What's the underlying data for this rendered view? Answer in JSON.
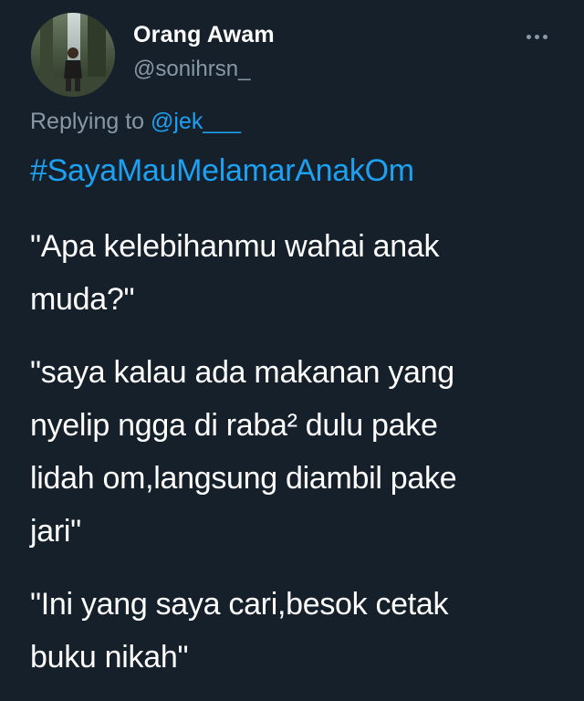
{
  "tweet": {
    "author": {
      "display_name": "Orang Awam",
      "handle": "@sonihrsn_",
      "avatar_icon": "user-avatar-photo"
    },
    "more_icon": "more-horizontal-icon",
    "replying_to": {
      "prefix": "Replying to ",
      "mention": "@jek___"
    },
    "hashtag": "#SayaMauMelamarAnakOm",
    "paragraphs": [
      "\"Apa kelebihanmu wahai anak\nmuda?\"",
      "\"saya kalau ada makanan yang\nnyelip ngga di raba² dulu pake\nlidah om,langsung diambil pake\njari\"",
      "\"Ini yang saya cari,besok cetak\nbuku nikah\""
    ]
  },
  "colors": {
    "background": "#15202b",
    "primary_text": "#ffffff",
    "secondary_text": "#8899a6",
    "accent": "#1da1f2"
  }
}
